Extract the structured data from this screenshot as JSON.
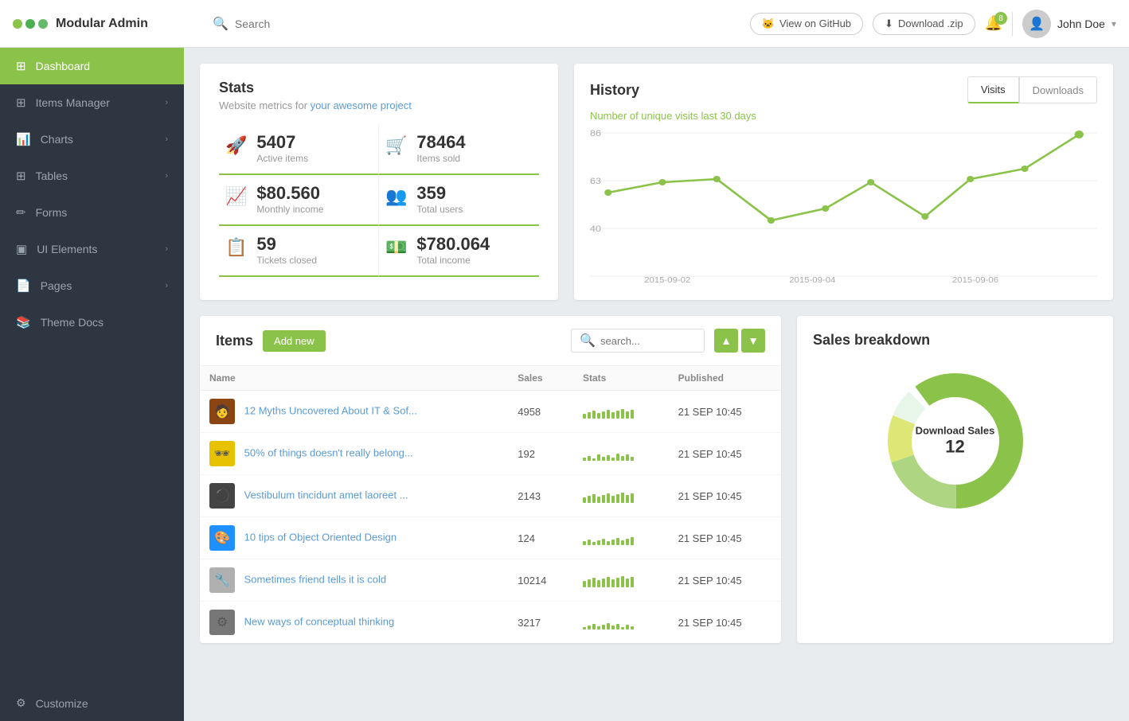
{
  "brand": {
    "name": "Modular Admin"
  },
  "topnav": {
    "search_placeholder": "Search",
    "view_github": "View on GitHub",
    "download_zip": "Download .zip",
    "bell_count": "8",
    "user_name": "John Doe"
  },
  "sidebar": {
    "items": [
      {
        "id": "dashboard",
        "label": "Dashboard",
        "icon": "⊞",
        "active": true,
        "has_arrow": false
      },
      {
        "id": "items-manager",
        "label": "Items Manager",
        "icon": "⊞",
        "active": false,
        "has_arrow": true
      },
      {
        "id": "charts",
        "label": "Charts",
        "icon": "📊",
        "active": false,
        "has_arrow": true
      },
      {
        "id": "tables",
        "label": "Tables",
        "icon": "⊞",
        "active": false,
        "has_arrow": true
      },
      {
        "id": "forms",
        "label": "Forms",
        "icon": "✏",
        "active": false,
        "has_arrow": false
      },
      {
        "id": "ui-elements",
        "label": "UI Elements",
        "icon": "▣",
        "active": false,
        "has_arrow": true
      },
      {
        "id": "pages",
        "label": "Pages",
        "icon": "📄",
        "active": false,
        "has_arrow": true
      },
      {
        "id": "theme-docs",
        "label": "Theme Docs",
        "icon": "📚",
        "active": false,
        "has_arrow": false
      }
    ],
    "bottom": {
      "label": "Customize",
      "icon": "⚙"
    }
  },
  "stats": {
    "title": "Stats",
    "subtitle": "Website metrics for",
    "subtitle_link": "your awesome project",
    "items": [
      {
        "icon": "🚀",
        "number": "5407",
        "label": "Active items"
      },
      {
        "icon": "🛒",
        "number": "78464",
        "label": "Items sold"
      },
      {
        "icon": "📈",
        "number": "$80.560",
        "label": "Monthly income"
      },
      {
        "icon": "👥",
        "number": "359",
        "label": "Total users"
      },
      {
        "icon": "📋",
        "number": "59",
        "label": "Tickets closed"
      },
      {
        "icon": "💵",
        "number": "$780.064",
        "label": "Total income"
      }
    ]
  },
  "history": {
    "title": "History",
    "subtitle": "Number of unique visits last 30 days",
    "tabs": [
      {
        "label": "Visits",
        "active": true
      },
      {
        "label": "Downloads",
        "active": false
      }
    ],
    "chart": {
      "y_labels": [
        "86",
        "63",
        "40"
      ],
      "x_labels": [
        "2015-09-02",
        "2015-09-04",
        "2015-09-06"
      ]
    }
  },
  "items": {
    "title": "Items",
    "add_new": "Add new",
    "search_placeholder": "search...",
    "columns": [
      "Name",
      "Sales",
      "Stats",
      "Published"
    ],
    "rows": [
      {
        "thumb_bg": "#8B4513",
        "thumb_emoji": "🧑",
        "name": "12 Myths Uncovered About IT & Sof...",
        "sales": "4958",
        "published": "21 SEP 10:45",
        "bars": [
          6,
          8,
          10,
          7,
          9,
          11,
          8,
          10,
          12,
          9,
          11
        ]
      },
      {
        "thumb_bg": "#FFD700",
        "thumb_emoji": "🕶",
        "name": "50% of things doesn't really belong...",
        "sales": "192",
        "published": "21 SEP 10:45",
        "bars": [
          4,
          6,
          3,
          8,
          5,
          7,
          4,
          9,
          6,
          8,
          5
        ]
      },
      {
        "thumb_bg": "#333",
        "thumb_emoji": "⚫",
        "name": "Vestibulum tincidunt amet laoreet ...",
        "sales": "2143",
        "published": "21 SEP 10:45",
        "bars": [
          7,
          9,
          11,
          8,
          10,
          12,
          9,
          11,
          13,
          10,
          12
        ]
      },
      {
        "thumb_bg": "#1E90FF",
        "thumb_emoji": "🎨",
        "name": "10 tips of Object Oriented Design",
        "sales": "124",
        "published": "21 SEP 10:45",
        "bars": [
          5,
          7,
          4,
          6,
          8,
          5,
          7,
          9,
          6,
          8,
          10
        ]
      },
      {
        "thumb_bg": "#e0e0e0",
        "thumb_emoji": "🔧",
        "name": "Sometimes friend tells it is cold",
        "sales": "10214",
        "published": "21 SEP 10:45",
        "bars": [
          8,
          10,
          12,
          9,
          11,
          13,
          10,
          12,
          14,
          11,
          13
        ]
      },
      {
        "thumb_bg": "#888",
        "thumb_emoji": "⚙",
        "name": "New ways of conceptual thinking",
        "sales": "3217",
        "published": "21 SEP 10:45",
        "bars": [
          3,
          5,
          7,
          4,
          6,
          8,
          5,
          7,
          3,
          6,
          4
        ]
      }
    ]
  },
  "sales": {
    "title": "Sales breakdown",
    "center_label": "Download Sales",
    "center_number": "12",
    "segments": [
      {
        "color": "#8bc34a",
        "value": 60
      },
      {
        "color": "#aed581",
        "value": 20
      },
      {
        "color": "#dce775",
        "value": 12
      },
      {
        "color": "#e8f5e9",
        "value": 8
      }
    ]
  }
}
